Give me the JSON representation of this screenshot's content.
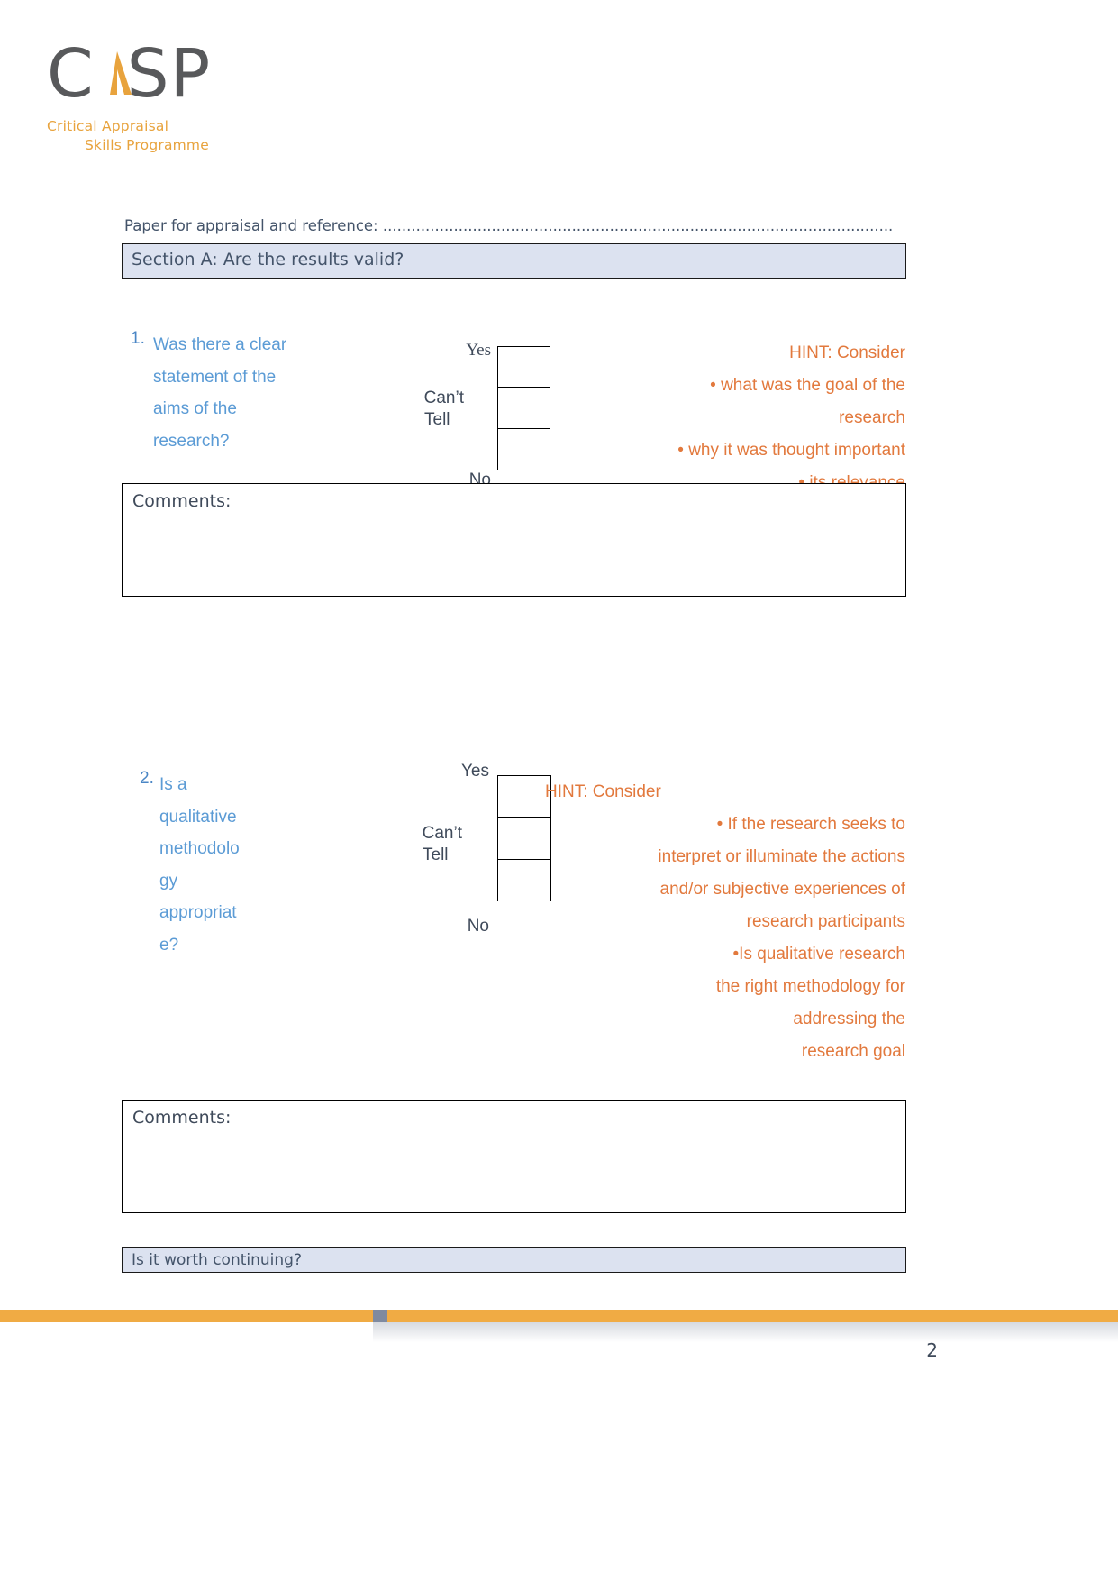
{
  "logo": {
    "letters_left": "C",
    "letters_right": "SP",
    "subtitle_line1": "Critical Appraisal",
    "subtitle_line2": "Skills Programme",
    "mark_color": "#58595B",
    "accent_color": "#E8A33D"
  },
  "header": {
    "paper_reference": "Paper for appraisal and reference: ............................................................................................................",
    "section_a": "Section A: Are the results valid?"
  },
  "answers": {
    "yes": "Yes",
    "cant_tell_line1": "Can’t",
    "cant_tell_line2": "Tell",
    "no": "No"
  },
  "comments_label": "Comments:",
  "questions": [
    {
      "number": "1.",
      "text_lines": [
        "Was there a clear",
        "statement of the",
        "aims of the",
        "research?"
      ],
      "hint_lines": [
        "HINT: Consider",
        "• what was the goal of the",
        "research",
        "• why it was thought important",
        "• its relevance"
      ]
    },
    {
      "number": "2.",
      "text_lines": [
        "Is a",
        "qualitative",
        "methodolo",
        "gy",
        "appropriat",
        "e?"
      ],
      "hint_lines": [
        "HINT: Consider",
        "•        If the research seeks to",
        "interpret or illuminate the actions",
        "and/or subjective experiences of",
        "research participants",
        "•Is qualitative research",
        "the right methodology for",
        "addressing the",
        "research goal"
      ]
    }
  ],
  "footer": {
    "worth_continuing": "Is it worth continuing?",
    "page_number": "2",
    "stripe_color": "#F0AB44"
  },
  "colors": {
    "question_blue": "#5B9BD5",
    "hint_orange": "#E2793D",
    "section_bar_fill": "#DCE2F0",
    "body_text": "#3F4A5A"
  }
}
